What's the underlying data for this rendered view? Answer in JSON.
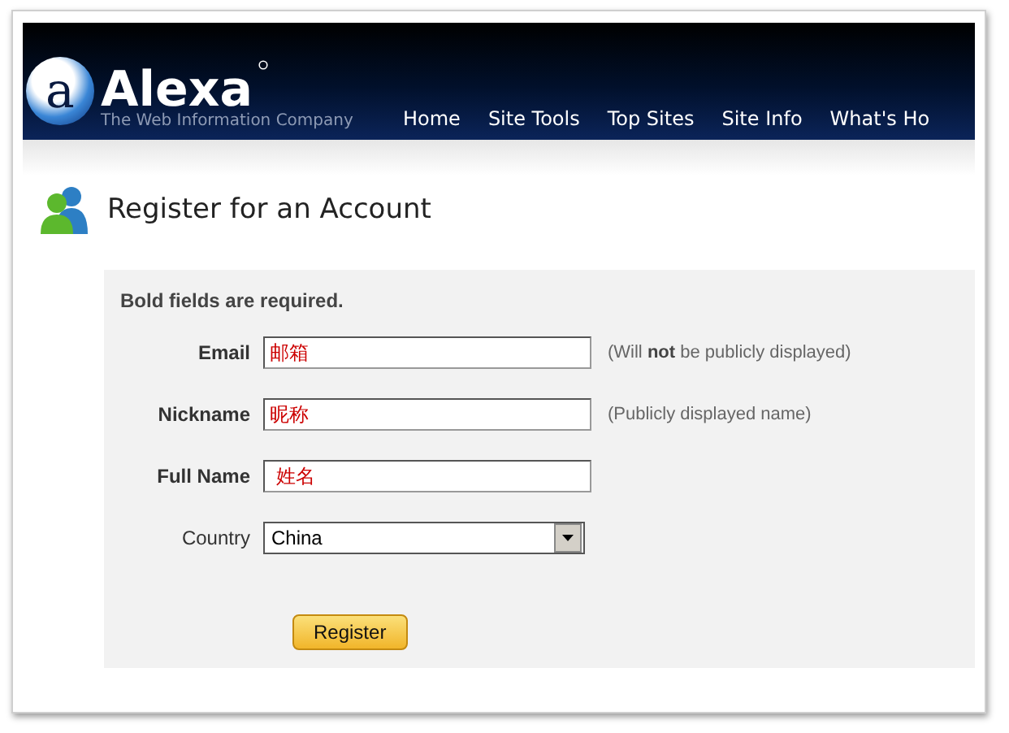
{
  "header": {
    "logo": "Alexa",
    "logo_letter": "a",
    "tagline": "The Web Information Company",
    "nav": [
      {
        "label": "Home"
      },
      {
        "label": "Site Tools"
      },
      {
        "label": "Top Sites"
      },
      {
        "label": "Site Info"
      },
      {
        "label": "What's Ho"
      }
    ]
  },
  "page_title": "Register for an Account",
  "form": {
    "note": "Bold fields are required.",
    "fields": [
      {
        "kind": "input",
        "label": "Email",
        "required": true,
        "value": "邮箱",
        "hint": "(Will **not** be publicly displayed)"
      },
      {
        "kind": "input",
        "label": "Nickname",
        "required": true,
        "value": "昵称",
        "hint": "(Publicly displayed name)"
      },
      {
        "kind": "input",
        "label": "Full Name",
        "required": true,
        "value": " 姓名"
      },
      {
        "kind": "select",
        "label": "Country",
        "required": false,
        "value": "China"
      }
    ],
    "submit": "Register"
  }
}
